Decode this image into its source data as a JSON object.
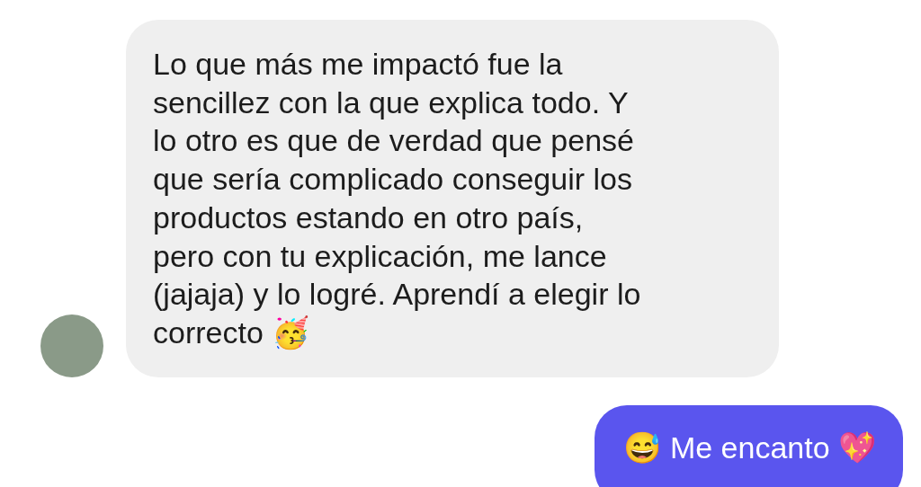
{
  "messages": [
    {
      "kind": "received",
      "text": "Lo que más me impactó fue la\nsencillez con la que explica todo. Y\nlo otro es que de verdad que pensé\nque sería complicado conseguir los\nproductos estando en otro país,\npero con tu explicación, me lance\n(jajaja) y lo logré. Aprendí a elegir lo\ncorrecto 🥳"
    },
    {
      "kind": "sent",
      "text": "😅 Me encanto 💖"
    }
  ]
}
